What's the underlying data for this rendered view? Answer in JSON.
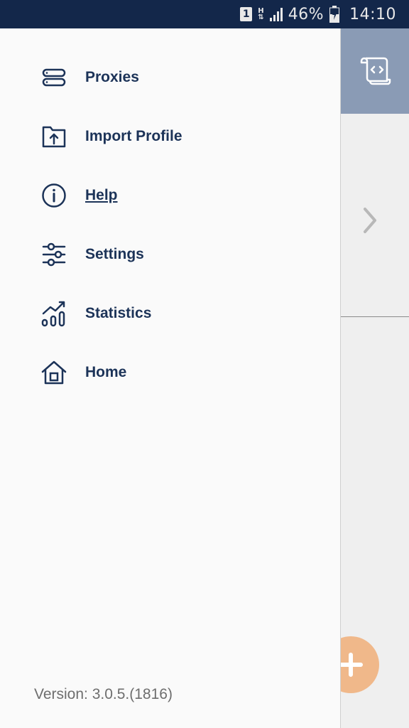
{
  "status_bar": {
    "sim": "1",
    "network": "H",
    "battery_percent": "46%",
    "time": "14:10"
  },
  "drawer": {
    "items": [
      {
        "label": "Proxies",
        "icon": "server-stack-icon"
      },
      {
        "label": "Import Profile",
        "icon": "folder-upload-icon"
      },
      {
        "label": "Help",
        "icon": "info-icon"
      },
      {
        "label": "Settings",
        "icon": "sliders-icon"
      },
      {
        "label": "Statistics",
        "icon": "chart-trend-icon"
      },
      {
        "label": "Home",
        "icon": "home-icon"
      }
    ],
    "version": "Version: 3.0.5.(1816)"
  },
  "colors": {
    "status_bar": "#13274a",
    "menu_text": "#1c3358",
    "header_bg": "#8a9bb5",
    "fab": "#f0b88a"
  }
}
